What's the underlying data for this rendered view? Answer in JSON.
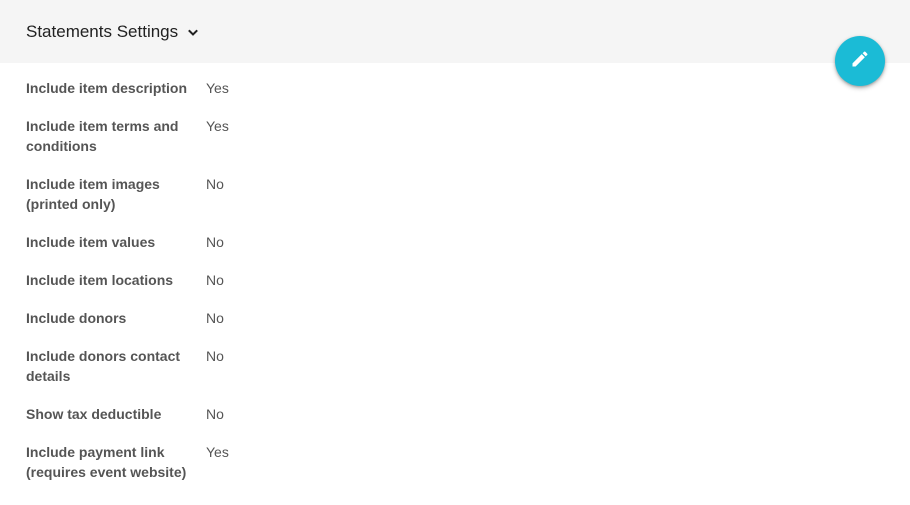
{
  "header": {
    "title": "Statements Settings",
    "dropdown_icon": "chevron-down-icon"
  },
  "fab": {
    "icon": "pencil-icon",
    "color": "#1bbbd6"
  },
  "settings": [
    {
      "label": "Include item description",
      "value": "Yes"
    },
    {
      "label": "Include item terms and conditions",
      "value": "Yes"
    },
    {
      "label": "Include item images (printed only)",
      "value": "No"
    },
    {
      "label": "Include item values",
      "value": "No"
    },
    {
      "label": "Include item locations",
      "value": "No"
    },
    {
      "label": "Include donors",
      "value": "No"
    },
    {
      "label": "Include donors contact details",
      "value": "No"
    },
    {
      "label": "Show tax deductible",
      "value": "No"
    },
    {
      "label": "Include payment link (requires event website)",
      "value": "Yes"
    }
  ]
}
